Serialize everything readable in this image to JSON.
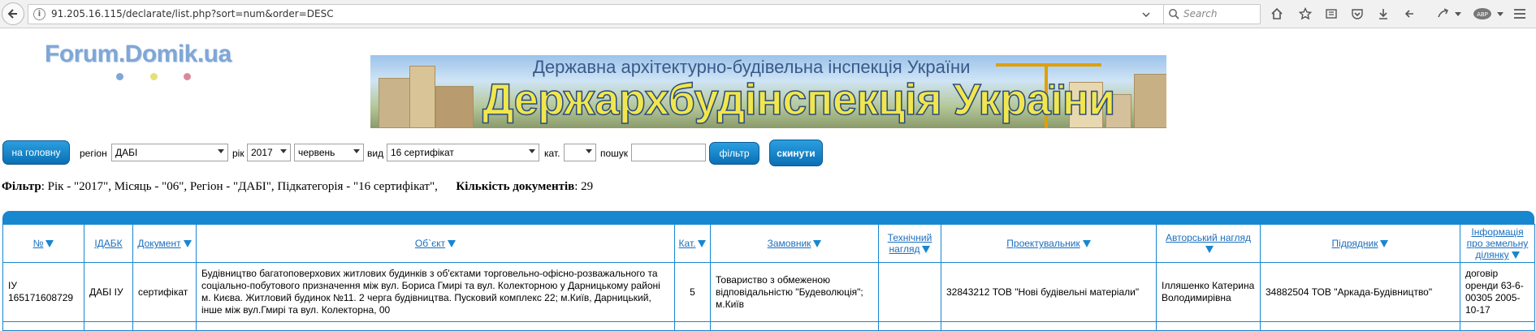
{
  "browser": {
    "url": "91.205.16.115/declarate/list.php?sort=num&order=DESC",
    "search_placeholder": "Search"
  },
  "logo": {
    "text": "Forum.Domik.ua",
    "dot_colors": [
      "#7fa7d6",
      "#e5df7a",
      "#d98a9a"
    ]
  },
  "banner": {
    "subtitle": "Державна архітектурно-будівельна інспекція України",
    "title": "Держархбудінспекція України"
  },
  "filters": {
    "home_button": "на головну",
    "region_label": "регіон",
    "region_value": "ДАБІ",
    "year_label": "рік",
    "year_value": "2017",
    "month_value": "червень",
    "type_label": "вид",
    "type_value": "16 сертифікат",
    "category_label": "кат.",
    "category_value": "",
    "search_label": "пошук",
    "search_value": "",
    "filter_button": "фільтр",
    "reset_button": "скинути"
  },
  "summary": {
    "filter_label": "Фільтр",
    "filter_text": ": Рік - \"2017\", Місяць - \"06\", Регіон - \"ДАБІ\", Підкатегорія - \"16 сертифікат\",",
    "count_label": "Кількість документів",
    "count_value": ": 29"
  },
  "table": {
    "columns": [
      "№",
      "ІДАБК",
      "Документ",
      "Об`єкт",
      "Кат.",
      "Замовник",
      "Технічний нагляд",
      "Проектувальник",
      "Авторський нагляд",
      "Підрядник",
      "Інформація про земельну ділянку"
    ],
    "rows": [
      {
        "num": "ІУ 165171608729",
        "idabk": "ДАБІ ІУ",
        "document": "сертифікат",
        "object": "Будівництво багатоповерхових житлових будинків з об'єктами торговельно-офісно-розважального та соціально-побутового призначення між вул. Бориса Гмирі та вул. Колекторною у Дарницькому районі м. Києва. Житловий будинок №11. 2 черга будівництва. Пусковий комплекс 22; м.Київ, Дарницький, інше між вул.Гмирі та вул. Колекторна, 00",
        "category": "5",
        "customer": "Товариство з обмеженою відповідальністю \"Будеволюція\"; м.Київ",
        "tech_supervision": "",
        "designer": "32843212 ТОВ \"Нові будівельні матеріали\"",
        "author_supervision": "Ілляшенко Катерина Володимирівна",
        "contractor": "34882504 ТОВ \"Аркада-Будівництво\"",
        "land_info": "договір оренди 63-6-00305 2005-10-17"
      }
    ]
  }
}
